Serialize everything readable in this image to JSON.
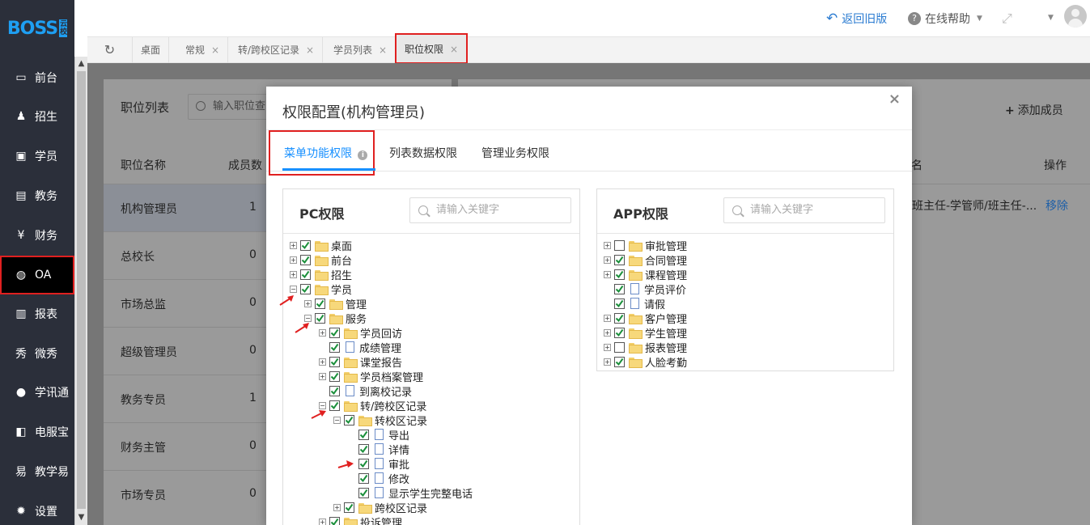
{
  "brand": {
    "logo_text": "BOSS",
    "logo_badge": "云校"
  },
  "sidebar": {
    "items": [
      {
        "label": "前台",
        "icon": "calendar-icon",
        "active": false
      },
      {
        "label": "招生",
        "icon": "add-user-icon",
        "active": false
      },
      {
        "label": "学员",
        "icon": "student-card-icon",
        "active": false
      },
      {
        "label": "教务",
        "icon": "book-icon",
        "active": false
      },
      {
        "label": "财务",
        "icon": "yen-icon",
        "active": false
      },
      {
        "label": "OA",
        "icon": "chat-bubbles-icon",
        "active": true
      },
      {
        "label": "报表",
        "icon": "bar-chart-icon",
        "active": false
      },
      {
        "label": "微秀",
        "icon": "show-icon",
        "active": false
      },
      {
        "label": "学讯通",
        "icon": "location-pin-icon",
        "active": false
      },
      {
        "label": "电服宝",
        "icon": "phone-service-icon",
        "active": false
      },
      {
        "label": "教学易",
        "icon": "teaching-icon",
        "active": false
      },
      {
        "label": "设置",
        "icon": "gear-icon",
        "active": false
      }
    ]
  },
  "topbar": {
    "back_label": "返回旧版",
    "help_label": "在线帮助"
  },
  "tabs": [
    {
      "label": "桌面",
      "closable": false
    },
    {
      "label": "常规",
      "closable": true
    },
    {
      "label": "转/跨校区记录",
      "closable": true
    },
    {
      "label": "学员列表",
      "closable": true
    },
    {
      "label": "职位权限",
      "closable": true,
      "active": true
    }
  ],
  "left_panel": {
    "title": "职位列表",
    "search_placeholder": "输入职位查",
    "col_name": "职位名称",
    "col_count": "成员数",
    "rows": [
      {
        "name": "机构管理员",
        "count": "1"
      },
      {
        "name": "总校长",
        "count": "0"
      },
      {
        "name": "市场总监",
        "count": "0"
      },
      {
        "name": "超级管理员",
        "count": "0"
      },
      {
        "name": "教务专员",
        "count": "1"
      },
      {
        "name": "财务主管",
        "count": "0"
      },
      {
        "name": "市场专员",
        "count": "0"
      }
    ]
  },
  "right_panel": {
    "add_member": "添加成员",
    "col_partial": "名",
    "col_action": "操作",
    "row_text": "班主任-学管师/班主任-...",
    "row_action": "移除"
  },
  "modal": {
    "title": "权限配置(机构管理员)",
    "close": "×",
    "tabs": [
      "菜单功能权限",
      "列表数据权限",
      "管理业务权限"
    ],
    "info_icon": "i",
    "pc": {
      "title": "PC权限",
      "placeholder": "请输入关键字",
      "nodes": [
        {
          "label": "桌面",
          "level": 0,
          "toggle": "+",
          "checked": true,
          "type": "folder"
        },
        {
          "label": "前台",
          "level": 0,
          "toggle": "+",
          "checked": true,
          "type": "folder"
        },
        {
          "label": "招生",
          "level": 0,
          "toggle": "+",
          "checked": true,
          "type": "folder"
        },
        {
          "label": "学员",
          "level": 0,
          "toggle": "-",
          "checked": true,
          "type": "folder"
        },
        {
          "label": "管理",
          "level": 1,
          "toggle": "+",
          "checked": true,
          "type": "folder"
        },
        {
          "label": "服务",
          "level": 1,
          "toggle": "-",
          "checked": true,
          "type": "folder"
        },
        {
          "label": "学员回访",
          "level": 2,
          "toggle": "+",
          "checked": true,
          "type": "folder"
        },
        {
          "label": "成绩管理",
          "level": 2,
          "toggle": "",
          "checked": true,
          "type": "file"
        },
        {
          "label": "课堂报告",
          "level": 2,
          "toggle": "+",
          "checked": true,
          "type": "folder"
        },
        {
          "label": "学员档案管理",
          "level": 2,
          "toggle": "+",
          "checked": true,
          "type": "folder"
        },
        {
          "label": "到离校记录",
          "level": 2,
          "toggle": "",
          "checked": true,
          "type": "file"
        },
        {
          "label": "转/跨校区记录",
          "level": 2,
          "toggle": "-",
          "checked": true,
          "type": "folder"
        },
        {
          "label": "转校区记录",
          "level": 3,
          "toggle": "-",
          "checked": true,
          "type": "folder"
        },
        {
          "label": "导出",
          "level": 4,
          "toggle": "",
          "checked": true,
          "type": "file"
        },
        {
          "label": "详情",
          "level": 4,
          "toggle": "",
          "checked": true,
          "type": "file"
        },
        {
          "label": "审批",
          "level": 4,
          "toggle": "",
          "checked": true,
          "type": "file"
        },
        {
          "label": "修改",
          "level": 4,
          "toggle": "",
          "checked": true,
          "type": "file"
        },
        {
          "label": "显示学生完整电话",
          "level": 4,
          "toggle": "",
          "checked": true,
          "type": "file"
        },
        {
          "label": "跨校区记录",
          "level": 3,
          "toggle": "+",
          "checked": true,
          "type": "folder"
        },
        {
          "label": "投诉管理",
          "level": 2,
          "toggle": "+",
          "checked": true,
          "type": "folder"
        }
      ]
    },
    "app": {
      "title": "APP权限",
      "placeholder": "请输入关键字",
      "nodes": [
        {
          "label": "审批管理",
          "level": 0,
          "toggle": "+",
          "checked": false,
          "type": "folder"
        },
        {
          "label": "合同管理",
          "level": 0,
          "toggle": "+",
          "checked": true,
          "type": "folder"
        },
        {
          "label": "课程管理",
          "level": 0,
          "toggle": "+",
          "checked": true,
          "type": "folder"
        },
        {
          "label": "学员评价",
          "level": 0,
          "toggle": "",
          "checked": true,
          "type": "file"
        },
        {
          "label": "请假",
          "level": 0,
          "toggle": "",
          "checked": true,
          "type": "file"
        },
        {
          "label": "客户管理",
          "level": 0,
          "toggle": "+",
          "checked": true,
          "type": "folder"
        },
        {
          "label": "学生管理",
          "level": 0,
          "toggle": "+",
          "checked": true,
          "type": "folder"
        },
        {
          "label": "报表管理",
          "level": 0,
          "toggle": "+",
          "checked": false,
          "type": "folder"
        },
        {
          "label": "人脸考勤",
          "level": 0,
          "toggle": "+",
          "checked": true,
          "type": "folder"
        }
      ]
    }
  },
  "colors": {
    "accent": "#1890ff",
    "highlight": "#e02020",
    "sidebar": "#2b2f3a"
  }
}
